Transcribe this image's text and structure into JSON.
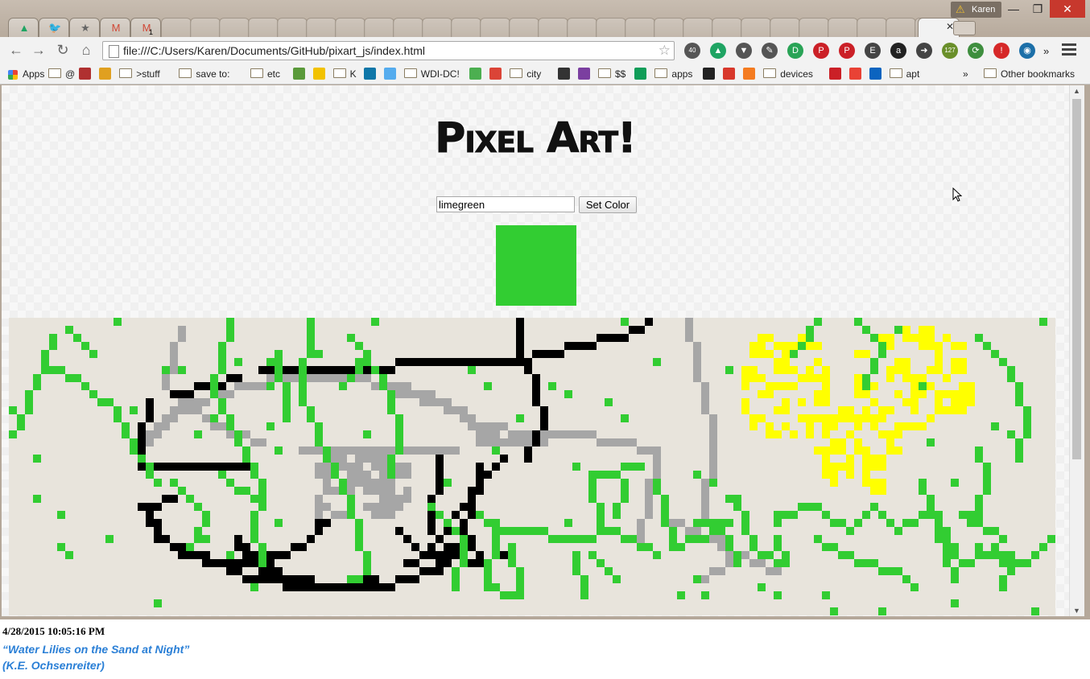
{
  "window": {
    "profile_name": "Karen",
    "tabs": [
      {
        "icon": "google-drive-icon",
        "glyph": "▲",
        "color": "#1fa463"
      },
      {
        "icon": "twitter-icon",
        "glyph": "🐦",
        "color": "#55acee"
      },
      {
        "icon": "star-icon",
        "glyph": "★",
        "color": "#666666"
      },
      {
        "icon": "gmail-icon",
        "glyph": "M",
        "color": "#d14836"
      },
      {
        "icon": "gmail-icon",
        "glyph": "M",
        "color": "#d14836",
        "badge": "1"
      }
    ],
    "controls": {
      "minimize": "—",
      "maximize": "❐",
      "close": "✕"
    }
  },
  "toolbar": {
    "back": "←",
    "forward": "→",
    "reload": "↻",
    "home": "⌂",
    "url": "file:///C:/Users/Karen/Documents/GitHub/pixart_js/index.html",
    "extensions": [
      {
        "name": "slides-ext-icon",
        "color": "#555555",
        "text": "40"
      },
      {
        "name": "google-drive-ext-icon",
        "color": "#1fa463",
        "text": "▲"
      },
      {
        "name": "pocket-icon",
        "color": "#555555",
        "text": "▼"
      },
      {
        "name": "tools-ext-icon",
        "color": "#555555",
        "text": "✎"
      },
      {
        "name": "pushbullet-icon",
        "color": "#29a356",
        "text": "D"
      },
      {
        "name": "pinterest-icon",
        "color": "#cb2027",
        "text": "P"
      },
      {
        "name": "pinterest-icon",
        "color": "#cb2027",
        "text": "P"
      },
      {
        "name": "evernote-icon",
        "color": "#444444",
        "text": "E"
      },
      {
        "name": "amazon-icon",
        "color": "#222222",
        "text": "a"
      },
      {
        "name": "send-to-device-icon",
        "color": "#444444",
        "text": "➜"
      },
      {
        "name": "todo-ext-icon",
        "color": "#6a8f2a",
        "text": "127"
      },
      {
        "name": "refresh-ext-icon",
        "color": "#3e8e3e",
        "text": "⟳"
      },
      {
        "name": "alert-ext-icon",
        "color": "#d62828",
        "text": "!"
      },
      {
        "name": "eye-ext-icon",
        "color": "#1c6fa8",
        "text": "◉"
      }
    ],
    "overflow": "»"
  },
  "bookmarks": [
    {
      "label": "Apps",
      "kind": "apps"
    },
    {
      "label": "@",
      "kind": "folder"
    },
    {
      "label": "",
      "kind": "icon",
      "color": "#b03030"
    },
    {
      "label": "",
      "kind": "icon",
      "color": "#e0a020"
    },
    {
      "label": ">stuff",
      "kind": "folder"
    },
    {
      "label": "save to:",
      "kind": "folder"
    },
    {
      "label": "etc",
      "kind": "folder"
    },
    {
      "label": "",
      "kind": "icon",
      "color": "#5a9a3a"
    },
    {
      "label": "",
      "kind": "icon",
      "color": "#f2c200"
    },
    {
      "label": "K",
      "kind": "folder"
    },
    {
      "label": "",
      "kind": "icon",
      "color": "#0e76a8"
    },
    {
      "label": "",
      "kind": "icon",
      "color": "#55acee"
    },
    {
      "label": "WDI-DC!",
      "kind": "folder"
    },
    {
      "label": "",
      "kind": "icon",
      "color": "#4caf50"
    },
    {
      "label": "",
      "kind": "icon",
      "color": "#db4437"
    },
    {
      "label": "city",
      "kind": "folder"
    },
    {
      "label": "",
      "kind": "icon",
      "color": "#333333"
    },
    {
      "label": "",
      "kind": "icon",
      "color": "#7b3fa0"
    },
    {
      "label": "$$",
      "kind": "folder"
    },
    {
      "label": "",
      "kind": "icon",
      "color": "#0f9d58"
    },
    {
      "label": "apps",
      "kind": "folder"
    },
    {
      "label": "",
      "kind": "icon",
      "color": "#222222"
    },
    {
      "label": "",
      "kind": "icon",
      "color": "#d8382b"
    },
    {
      "label": "",
      "kind": "icon",
      "color": "#f47b20"
    },
    {
      "label": "devices",
      "kind": "folder"
    },
    {
      "label": "",
      "kind": "icon",
      "color": "#cb2027"
    },
    {
      "label": "",
      "kind": "icon",
      "color": "#e94235"
    },
    {
      "label": "",
      "kind": "icon",
      "color": "#0b64c0"
    },
    {
      "label": "apt",
      "kind": "folder"
    }
  ],
  "bookmarks_overflow": "»",
  "other_bookmarks": "Other bookmarks",
  "page": {
    "title": "Pixel Art!",
    "color_input_value": "limegreen",
    "set_color_button": "Set Color",
    "swatch_color": "#32cd32",
    "canvas_background": "#e8e4dc",
    "palette": {
      "G": "#32cd32",
      "B": "#000000",
      "Y": "#ffff00",
      "S": "#a6a6a6"
    }
  },
  "footer": {
    "timestamp": "4/28/2015 10:05:16 PM",
    "caption_title": "“Water Lilies on the Sand at Night”",
    "caption_author": "(K.E. Ochsenreiter)"
  }
}
